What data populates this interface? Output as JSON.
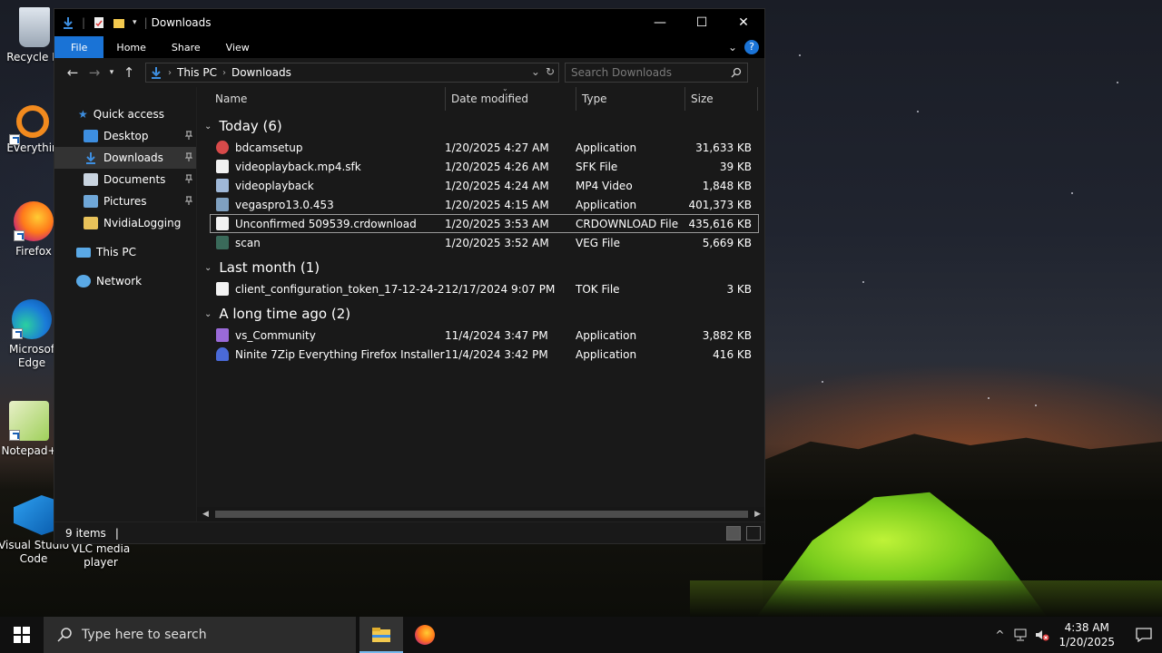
{
  "desktop": {
    "icons": [
      {
        "label": "Recycle Bi"
      },
      {
        "label": "Everythin"
      },
      {
        "label": "Firefox"
      },
      {
        "label": "Microsof Edge"
      },
      {
        "label": "Notepad+"
      },
      {
        "label": "Visual Studio Code"
      },
      {
        "label": "VLC media player"
      }
    ]
  },
  "window": {
    "title": "Downloads",
    "ribbon_tabs": [
      "File",
      "Home",
      "Share",
      "View"
    ],
    "address": {
      "crumbs": [
        "This PC",
        "Downloads"
      ]
    },
    "search_placeholder": "Search Downloads",
    "columns": [
      "Name",
      "Date modified",
      "Type",
      "Size"
    ],
    "sidebar": [
      {
        "label": "Quick access",
        "color": "#3d8ee0"
      },
      {
        "label": "Desktop",
        "color": "#3d8ee0"
      },
      {
        "label": "Downloads",
        "color": "#3d8ee0"
      },
      {
        "label": "Documents",
        "color": "#c9d4e0"
      },
      {
        "label": "Pictures",
        "color": "#6fa7d8"
      },
      {
        "label": "NvidiaLogging",
        "color": "#e8c25a"
      },
      {
        "label": "This PC",
        "color": "#5aa9e6"
      },
      {
        "label": "Network",
        "color": "#5aa9e6"
      }
    ],
    "groups": [
      {
        "title": "Today (6)",
        "files": [
          {
            "name": "bdcamsetup",
            "date": "1/20/2025 4:27 AM",
            "type": "Application",
            "size": "31,633 KB",
            "icon_color": "#d84a4a"
          },
          {
            "name": "videoplayback.mp4.sfk",
            "date": "1/20/2025 4:26 AM",
            "type": "SFK File",
            "size": "39 KB",
            "icon_color": "#f2f2f2"
          },
          {
            "name": "videoplayback",
            "date": "1/20/2025 4:24 AM",
            "type": "MP4 Video",
            "size": "1,848 KB",
            "icon_color": "#9fb8d8"
          },
          {
            "name": "vegaspro13.0.453",
            "date": "1/20/2025 4:15 AM",
            "type": "Application",
            "size": "401,373 KB",
            "icon_color": "#7fa0c0"
          },
          {
            "name": "Unconfirmed 509539.crdownload",
            "date": "1/20/2025 3:53 AM",
            "type": "CRDOWNLOAD File",
            "size": "435,616 KB",
            "icon_color": "#f2f2f2"
          },
          {
            "name": "scan",
            "date": "1/20/2025 3:52 AM",
            "type": "VEG File",
            "size": "5,669 KB",
            "icon_color": "#3a6a5a"
          }
        ]
      },
      {
        "title": "Last month (1)",
        "files": [
          {
            "name": "client_configuration_token_17-12-24-21-...",
            "date": "12/17/2024 9:07 PM",
            "type": "TOK File",
            "size": "3 KB",
            "icon_color": "#f2f2f2"
          }
        ]
      },
      {
        "title": "A long time ago (2)",
        "files": [
          {
            "name": "vs_Community",
            "date": "11/4/2024 3:47 PM",
            "type": "Application",
            "size": "3,882 KB",
            "icon_color": "#9a6ad8"
          },
          {
            "name": "Ninite 7Zip Everything Firefox Installer",
            "date": "11/4/2024 3:42 PM",
            "type": "Application",
            "size": "416 KB",
            "icon_color": "#4a6ad8"
          }
        ]
      }
    ],
    "status": "9 items"
  },
  "taskbar": {
    "search_placeholder": "Type here to search",
    "time": "4:38 AM",
    "date": "1/20/2025"
  }
}
